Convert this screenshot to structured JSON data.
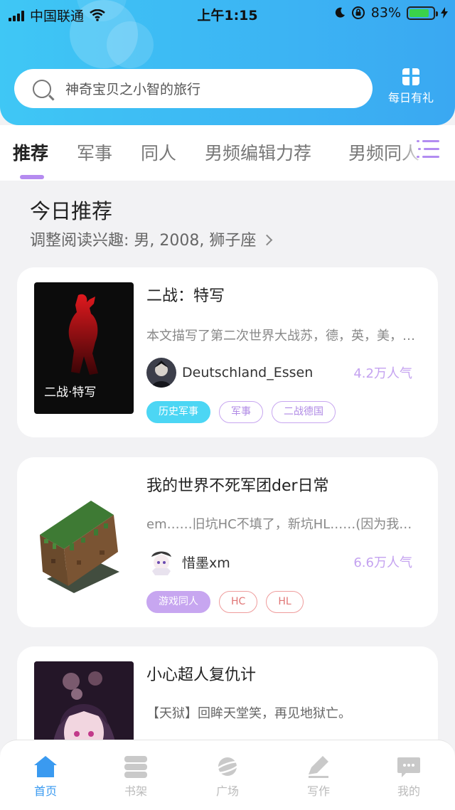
{
  "status_bar": {
    "carrier": "中国联通",
    "time": "上午1:15",
    "battery_percent": "83%",
    "battery_level": 0.83
  },
  "header": {
    "search_placeholder": "神奇宝贝之小智的旅行",
    "gift_label": "每日有礼"
  },
  "tabs": [
    {
      "label": "推荐",
      "active": true
    },
    {
      "label": "军事",
      "active": false
    },
    {
      "label": "同人",
      "active": false
    },
    {
      "label": "男频编辑力荐",
      "active": false
    },
    {
      "label": "男频同人",
      "active": false
    }
  ],
  "section": {
    "title": "今日推荐",
    "subtitle": "调整阅读兴趣: 男, 2008, 狮子座"
  },
  "books": [
    {
      "title": "二战：特写",
      "cover_text": "二战·特写",
      "description": "本文描写了第二次世界大战苏，德，英，美，日等国的",
      "author": "Deutschland_Essen",
      "popularity": "4.2万人气",
      "tags": [
        "历史军事",
        "军事",
        "二战德国"
      ]
    },
    {
      "title": "我的世界不死军团der日常",
      "description": "em……旧坑HC不填了，新坑HL……(因为我没有存稿",
      "author": "惜墨xm",
      "popularity": "6.6万人气",
      "tags": [
        "游戏同人",
        "HC",
        "HL"
      ]
    },
    {
      "title": "小心超人复仇计",
      "description": "【天狱】回眸天堂笑，再见地狱亡。"
    }
  ],
  "bottom_nav": [
    {
      "label": "首页",
      "icon": "home-icon",
      "active": true
    },
    {
      "label": "书架",
      "icon": "bookshelf-icon",
      "active": false
    },
    {
      "label": "广场",
      "icon": "planet-icon",
      "active": false
    },
    {
      "label": "写作",
      "icon": "pen-icon",
      "active": false
    },
    {
      "label": "我的",
      "icon": "chat-icon",
      "active": false
    }
  ],
  "colors": {
    "header_gradient_start": "#3fc7f5",
    "header_gradient_end": "#3aa8f2",
    "accent_purple": "#b58bf0",
    "nav_active": "#3a9af0"
  }
}
